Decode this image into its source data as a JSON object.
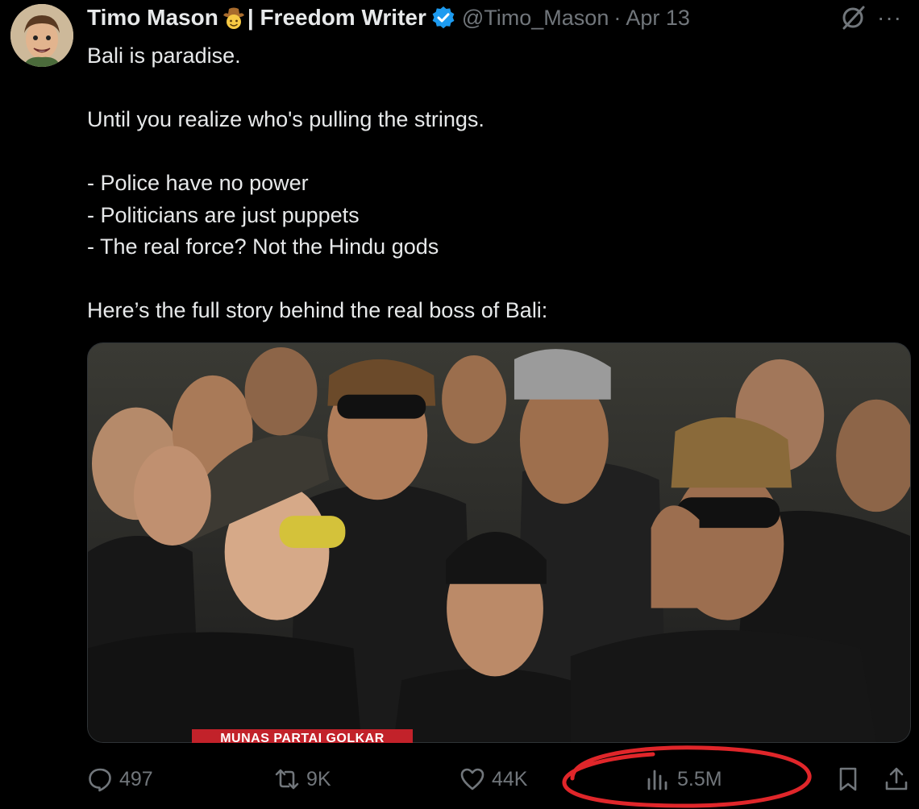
{
  "header": {
    "display_name": "Timo Mason",
    "name_suffix": "| Freedom Writer",
    "handle": "@Timo_Mason",
    "separator": "·",
    "date": "Apr 13",
    "more_label": "···"
  },
  "tweet": {
    "lines": [
      "Bali is paradise.",
      "",
      "Until you realize who's pulling the strings.",
      "",
      "- Police have no power",
      "- Politicians are just puppets",
      "- The real force? Not the Hindu gods",
      "",
      "Here’s the full story behind the real boss of Bali:"
    ]
  },
  "media": {
    "caption_band": "MUNAS PARTAI GOLKAR"
  },
  "actions": {
    "replies": "497",
    "reposts": "9K",
    "likes": "44K",
    "views": "5.5M"
  },
  "colors": {
    "background": "#000000",
    "text": "#e7e9ea",
    "muted": "#71767b",
    "verified": "#1d9bf0",
    "annotation_circle": "#e0262a"
  },
  "icons": {
    "reply": "reply-icon",
    "repost": "repost-icon",
    "like": "heart-icon",
    "views": "views-bar-icon",
    "bookmark": "bookmark-icon",
    "share": "share-icon",
    "grok": "grok-icon",
    "verified": "verified-badge-icon",
    "emoji": "cowboy-emoji-icon"
  }
}
